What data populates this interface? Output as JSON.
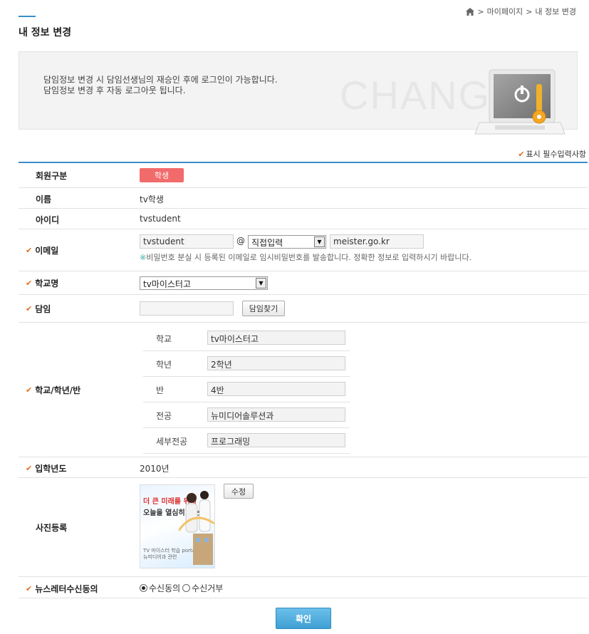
{
  "header": {
    "title": "내 정보 변경",
    "breadcrumb": [
      "마이페이지",
      "내 정보 변경"
    ],
    "breadcrumb_sep": ">"
  },
  "notice": {
    "line1": "담임정보 변경 시 담임선생님의 재승인 후에 로그인이 가능합니다.",
    "line2": "담임정보 변경 후 자동 로그아웃 됩니다.",
    "bg_text": "CHANG",
    "illustration": "laptop-power-key-icon"
  },
  "legend": {
    "check": "✔",
    "text": "표시 필수입력사항"
  },
  "colors": {
    "accent": "#3a8fc9",
    "badge": "#f26b6b",
    "required": "#e07020",
    "confirm": "#3f9fd4"
  },
  "form": {
    "member_type": {
      "label": "회원구분",
      "value": "학생"
    },
    "name": {
      "label": "이름",
      "value": "tv학생"
    },
    "id": {
      "label": "아이디",
      "value": "tvstudent"
    },
    "email": {
      "label": "이메일",
      "local": "tvstudent",
      "at": "@",
      "domain_select": "직접입력",
      "domain": "meister.go.kr",
      "hint_mark": "※",
      "hint": "비밀번호 분실 시 등록된 이메일로 임시비밀번호를 발송합니다. 정확한 정보로 입력하시기 바랍니다."
    },
    "school": {
      "label": "학교명",
      "value": "tv마이스터고"
    },
    "homeroom": {
      "label": "담임",
      "value": "",
      "button": "담임찾기"
    },
    "class_info": {
      "label": "학교/학년/반",
      "rows": [
        {
          "label": "학교",
          "value": "tv마이스터고"
        },
        {
          "label": "학년",
          "value": "2학년"
        },
        {
          "label": "반",
          "value": "4반"
        },
        {
          "label": "전공",
          "value": "뉴미디어솔루션과"
        },
        {
          "label": "세부전공",
          "value": "프로그래밍"
        }
      ]
    },
    "entry_year": {
      "label": "입학년도",
      "value": "2010년"
    },
    "photo": {
      "label": "사진등록",
      "button": "수정",
      "img_line1": "더 큰 미래를 위해",
      "img_line2": "오늘을 열심히 가는 곳",
      "img_line3": "TV 마이스터 학습 portal",
      "img_line4": "뉴미디어과 관련"
    },
    "newsletter": {
      "label": "뉴스레터수신동의",
      "agree": "수신동의",
      "reject": "수신거부",
      "selected": "agree"
    }
  },
  "submit": {
    "label": "확인"
  }
}
